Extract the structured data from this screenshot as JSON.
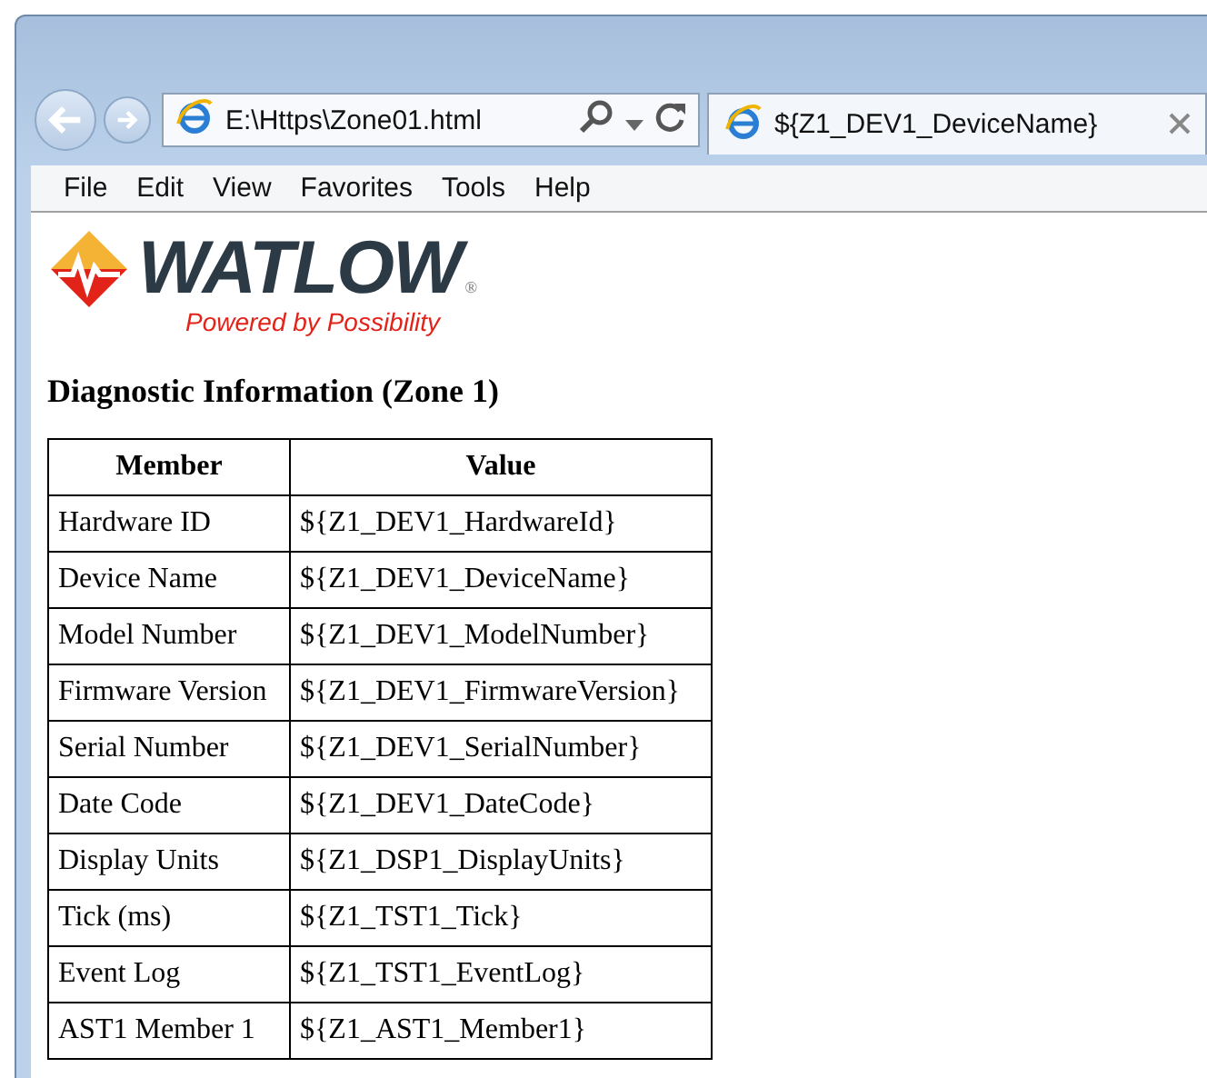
{
  "browser": {
    "address": "E:\\Https\\Zone01.html",
    "tab": {
      "title": "${Z1_DEV1_DeviceName}",
      "selected": true
    }
  },
  "menu": [
    "File",
    "Edit",
    "View",
    "Favorites",
    "Tools",
    "Help"
  ],
  "logo": {
    "wordmark": "WATLOW",
    "registered": "®",
    "tagline": "Powered by Possibility"
  },
  "heading": "Diagnostic Information (Zone 1)",
  "table": {
    "columns": [
      "Member",
      "Value"
    ],
    "rows": [
      [
        "Hardware ID",
        "${Z1_DEV1_HardwareId}"
      ],
      [
        "Device Name",
        "${Z1_DEV1_DeviceName}"
      ],
      [
        "Model Number",
        "${Z1_DEV1_ModelNumber}"
      ],
      [
        "Firmware Version",
        "${Z1_DEV1_FirmwareVersion}"
      ],
      [
        "Serial Number",
        "${Z1_DEV1_SerialNumber}"
      ],
      [
        "Date Code",
        "${Z1_DEV1_DateCode}"
      ],
      [
        "Display Units",
        "${Z1_DSP1_DisplayUnits}"
      ],
      [
        "Tick (ms)",
        "${Z1_TST1_Tick}"
      ],
      [
        "Event Log",
        "${Z1_TST1_EventLog}"
      ],
      [
        "AST1 Member 1",
        "${Z1_AST1_Member1}"
      ]
    ]
  }
}
